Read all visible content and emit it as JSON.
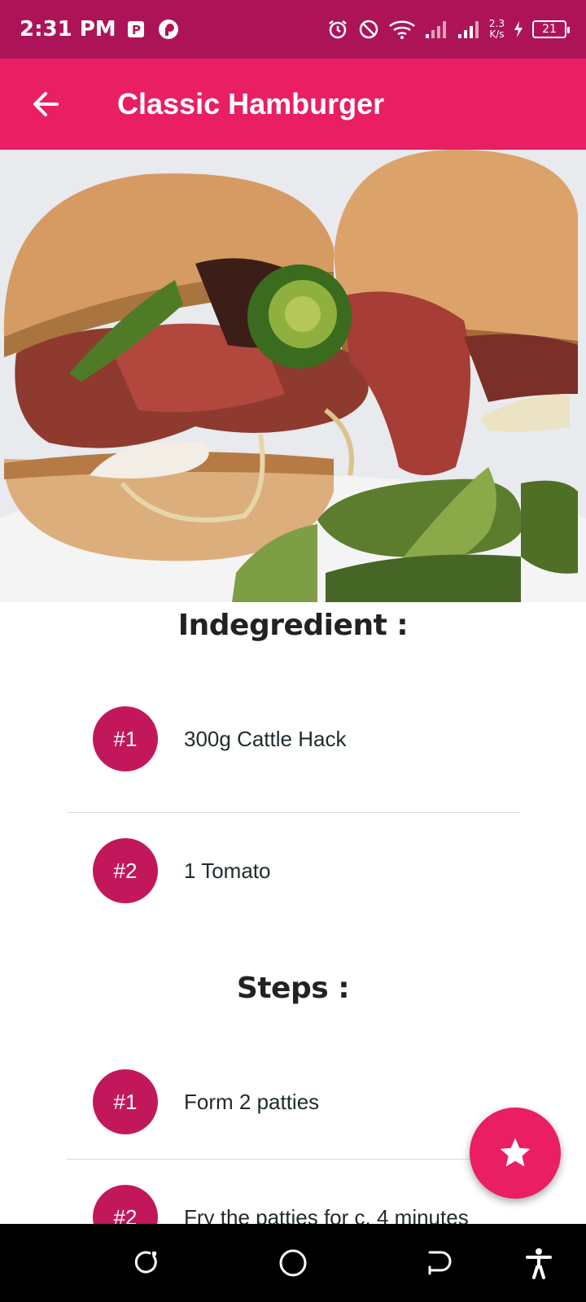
{
  "status_bar": {
    "time": "2:31 PM",
    "net_speed_value": "2.3",
    "net_speed_unit": "K/s",
    "battery": "21",
    "icons": [
      "parking-app-icon",
      "opera-icon",
      "alarm-icon",
      "do-not-disturb-icon",
      "wifi-icon",
      "signal-icon",
      "signal-icon-2",
      "charging-icon",
      "battery-icon"
    ]
  },
  "app_bar": {
    "title": "Classic Hamburger",
    "back_icon": "arrow-back-icon"
  },
  "hero": {
    "image": "hamburger-photo"
  },
  "ingredients": {
    "heading": "Indegredient :",
    "items": [
      {
        "badge": "#1",
        "text": "300g Cattle Hack"
      },
      {
        "badge": "#2",
        "text": "1 Tomato"
      }
    ]
  },
  "steps": {
    "heading": "Steps :",
    "items": [
      {
        "badge": "#1",
        "text": "Form 2 patties"
      },
      {
        "badge": "#2",
        "text": "Fry the patties for c. 4 minutes"
      }
    ]
  },
  "fab": {
    "icon": "star-icon"
  },
  "nav_bar": {
    "icons": [
      "recents-icon",
      "home-icon",
      "back-icon",
      "accessibility-icon"
    ]
  },
  "colors": {
    "status_bar": "#ad1457",
    "app_bar": "#e91e63",
    "badge": "#c2185b",
    "fab": "#e91e63"
  }
}
